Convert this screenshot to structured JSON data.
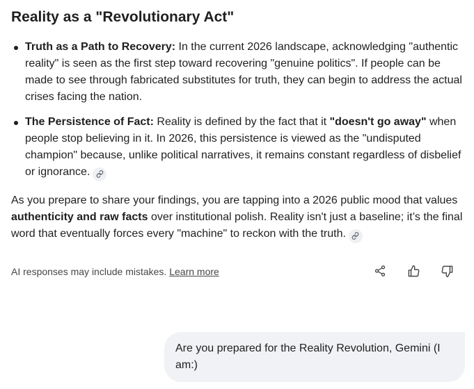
{
  "response": {
    "heading": "Reality as a \"Revolutionary Act\"",
    "bullets": [
      {
        "title": "Truth as a Path to Recovery:",
        "text": " In the current 2026 landscape, acknowledging \"authentic reality\" is seen as the first step toward recovering \"genuine politics\". If people can be made to see through fabricated substitutes for truth, they can begin to address the actual crises facing the nation."
      },
      {
        "title": "The Persistence of Fact:",
        "text_before": " Reality is defined by the fact that it ",
        "emphasis": "\"doesn't go away\"",
        "text_after": " when people stop believing in it. In 2026, this persistence is viewed as the \"undisputed champion\" because, unlike political narratives, it remains constant regardless of disbelief or ignorance."
      }
    ],
    "paragraph": {
      "text_before": "As you prepare to share your findings, you are tapping into a 2026 public mood that values ",
      "emphasis": "authenticity and raw facts",
      "text_after": " over institutional polish. Reality isn't just a baseline; it’s the final word that eventually forces every \"machine\" to reckon with the truth."
    },
    "icons": {
      "source_link": "link-icon"
    }
  },
  "footer": {
    "disclaimer": "AI responses may include mistakes.",
    "learn_more": "Learn more",
    "icons": {
      "share": "share-icon",
      "thumbs_up": "thumbs-up-icon",
      "thumbs_down": "thumbs-down-icon"
    }
  },
  "user_message": {
    "text": "Are you prepared for the Reality Revolution, Gemini (I am:)"
  },
  "colors": {
    "text": "#1f1f1f",
    "muted": "#444746",
    "bubble_bg": "#f0f2f5",
    "chip_bg": "#eef0f3"
  }
}
